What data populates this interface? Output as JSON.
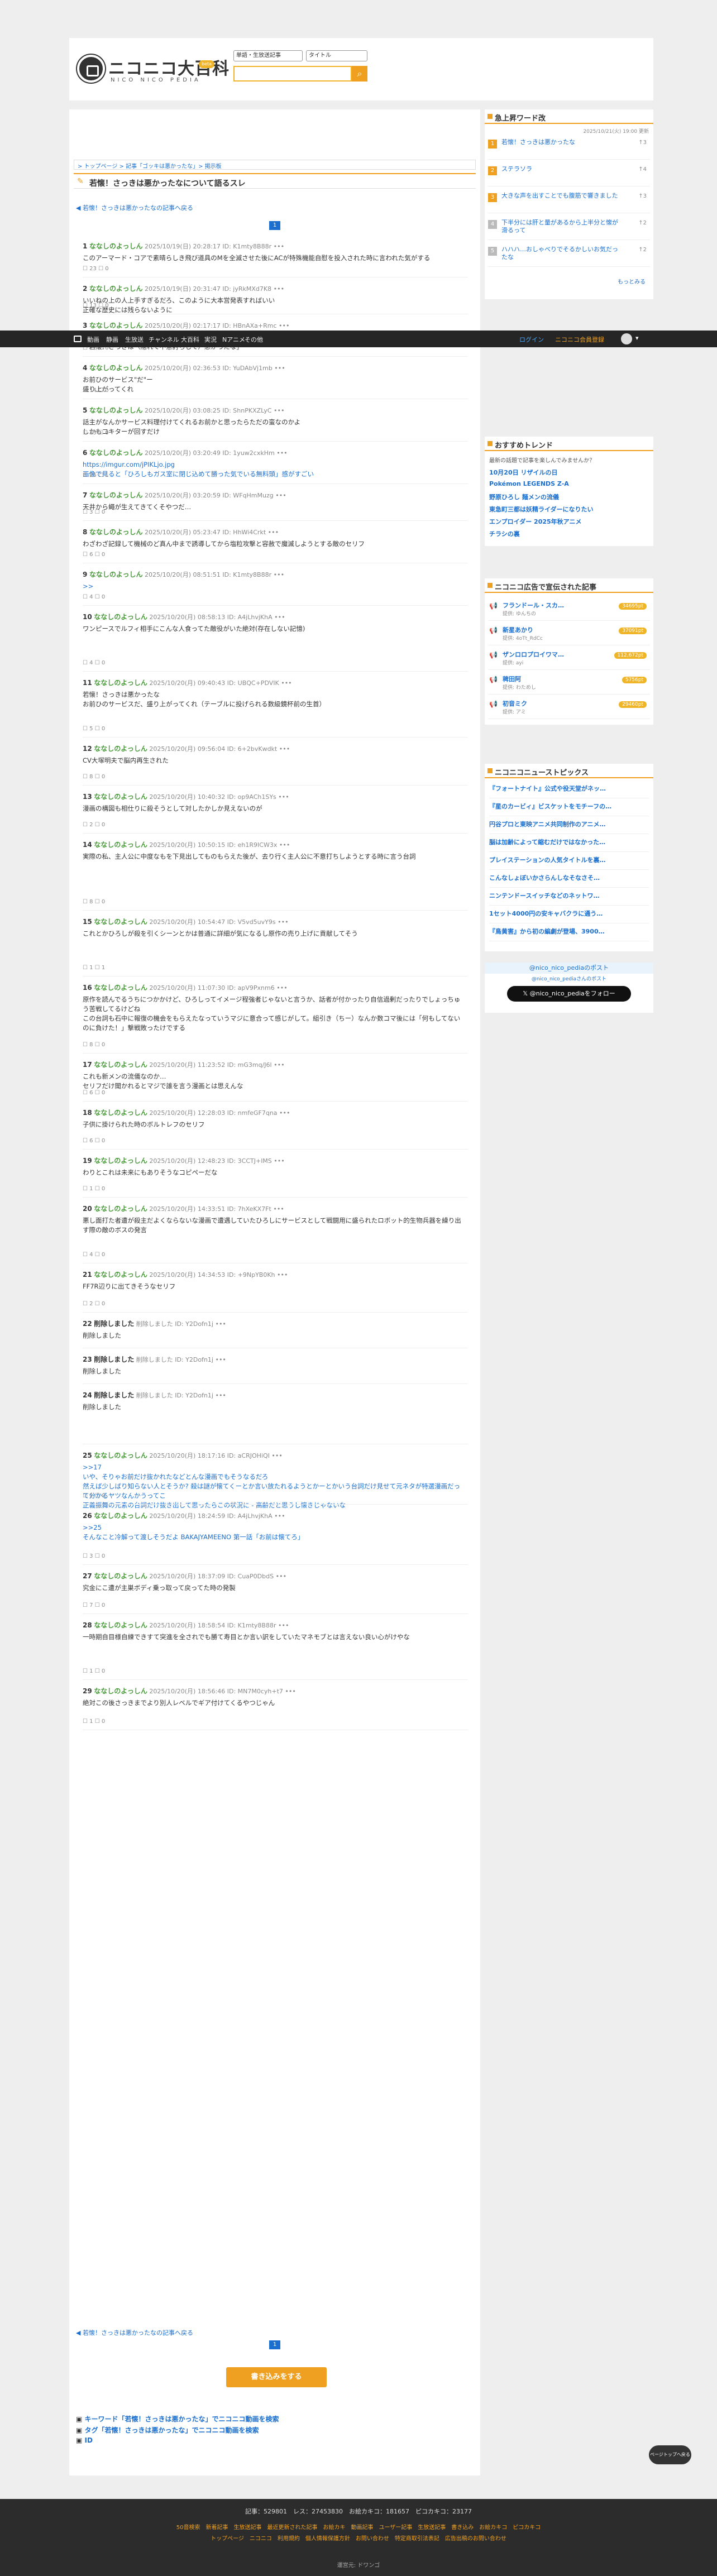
{
  "header": {
    "logo": "ニコニコ大百科",
    "logo_sub": "NICO NICO PEDIA",
    "beta": "beta",
    "search_scope": "単語・生放送記事",
    "search_field": "タイトル",
    "search_placeholder": ""
  },
  "nav": {
    "items": [
      "動画",
      "静画",
      "生放送",
      "チャンネル",
      "大百科",
      "実況",
      "Nアニメ",
      "その他"
    ],
    "login": "ログイン",
    "register": "ニコニコ会員登録"
  },
  "breadcrumb": "> トップページ > 記事「ゴッキは悪かったな」> 掲示板",
  "page_title": "若懐！さっきは悪かったなについて語るスレ",
  "back_link": "若懐！さっきは悪かったなの記事へ戻る",
  "page_number": "1",
  "posts": [
    {
      "num": "1",
      "name": "ななしのよっしん",
      "meta": "2025/10/19(日) 20:28:17 ID: K1mty8B88r",
      "body": "このアーマード・コアで素晴らしき飛び道具のMを全滅させた後にACが特殊機能自慰を投入された時に言われた気がする",
      "likes": "23",
      "dislikes": "0",
      "h": 68
    },
    {
      "num": "2",
      "name": "ななしのよっしん",
      "meta": "2025/10/19(日) 20:31:47 ID: jyRkMXd7K8",
      "body": "いいねの上の人上手すぎるだろ、このように大本営発表すればいい\n正確な歴史には残らないように",
      "likes": "13",
      "dislikes": "0",
      "h": 58
    },
    {
      "num": "3",
      "name": "ななしのよっしん",
      "meta": "2025/10/20(月) 02:17:17 ID: HBnAXa+Rmc",
      "body": "意外な理性発揮して来た若手の対戦相手を讃えてるヒール側のセリフやらこれ\n「若懐！さっきは（隠れて不意討ちして）悪かったな」",
      "likes": "22",
      "dislikes": "0",
      "h": 68
    },
    {
      "num": "4",
      "name": "ななしのよっしん",
      "meta": "2025/10/20(月) 02:36:53 ID: YuDAbVj1mb",
      "body": "お前ひのサービス\"だ\"ー\n盛り上がってくれ",
      "likes": "14",
      "dislikes": "0",
      "h": 68
    },
    {
      "num": "5",
      "name": "ななしのよっしん",
      "meta": "2025/10/20(月) 03:08:25 ID: ShnPKXZLyC",
      "body": "話主がなんかサービス料理付けてくれるお前かと思ったらただの蛮なのかよ\nしかもコキターが回すだけ",
      "likes": "13",
      "dislikes": "0",
      "h": 68
    },
    {
      "num": "6",
      "name": "ななしのよっしん",
      "meta": "2025/10/20(月) 03:20:49 ID: 1yuw2cxkHm",
      "body": "https://imgur.com/jPIKLjo.jpg\n画像で見ると「ひろしもガス室に閉じ込めて勝った気でいる無料頭」感がすごい",
      "likes": "25",
      "dislikes": "1",
      "h": 68
    },
    {
      "num": "7",
      "name": "ななしのよっしん",
      "meta": "2025/10/20(月) 03:20:59 ID: WFqHmMuzg",
      "body": "天井から蠅が生えてきてくそやつだ…",
      "likes": "3",
      "dislikes": "0",
      "h": 58
    },
    {
      "num": "8",
      "name": "ななしのよっしん",
      "meta": "2025/10/20(月) 05:23:47 ID: HhWi4Crkt",
      "body": "わざわざ記録して機械のど真ん中まで誘導してから塩粒攻撃と容赦で魔滅しようとする敵のセリフ",
      "likes": "6",
      "dislikes": "0",
      "h": 68
    },
    {
      "num": "9",
      "name": "ななしのよっしん",
      "meta": "2025/10/20(月) 08:51:51 ID: K1mty8B88r",
      "body": ">>",
      "likes": "4",
      "dislikes": "0",
      "h": 68
    },
    {
      "num": "10",
      "name": "ななしのよっしん",
      "meta": "2025/10/20(月) 08:58:13 ID: A4jLhvjKhA",
      "body": "ワンピースでルフィ相手にこんな人食ってた敵役がいた絶対(存在しない記憶)",
      "likes": "4",
      "dislikes": "0",
      "h": 110
    },
    {
      "num": "11",
      "name": "ななしのよっしん",
      "meta": "2025/10/20(月) 09:40:43 ID: UBQC+PDVIK",
      "body": "若懐！さっきは悪かったな\nお前ひのサービスだ、盛り上がってくれ（テーブルに投げられる数級鏡杯前の生首）",
      "likes": "5",
      "dislikes": "0",
      "h": 110
    },
    {
      "num": "12",
      "name": "ななしのよっしん",
      "meta": "2025/10/20(月) 09:56:04 ID: 6+2bvKwdkt",
      "body": "CV大塚明夫で脳内再生された",
      "likes": "8",
      "dislikes": "0",
      "h": 78
    },
    {
      "num": "13",
      "name": "ななしのよっしん",
      "meta": "2025/10/20(月) 10:40:32 ID: op9ACh1SYs",
      "body": "漫画の構図も相仕りに殺そうとして対したかしか見えないのが",
      "likes": "2",
      "dislikes": "0",
      "h": 78
    },
    {
      "num": "14",
      "name": "ななしのよっしん",
      "meta": "2025/10/20(月) 10:50:15 ID: eh1R9ICW3x",
      "body": "実際の私、主人公に中度なもを下見出してものもらえた後が、去り行く主人公に不意打ちしようとする時に言う台詞",
      "likes": "8",
      "dislikes": "0",
      "h": 130
    },
    {
      "num": "15",
      "name": "ななしのよっしん",
      "meta": "2025/10/20(月) 10:54:47 ID: V5vd5uvY9s",
      "body": "これとかひろしが殺を引くシーンとかは普通に詳細が気になるし原作の売り上げに貢献してそう",
      "likes": "1",
      "dislikes": "1",
      "h": 110
    },
    {
      "num": "16",
      "name": "ななしのよっしん",
      "meta": "2025/10/20(月) 11:07:30 ID: apV9Pxnm6",
      "body": "原作を読んでるうちにつかかけど、ひろしってイメージ程強者じゃないと言うか、話者が付かったり自信過剰だったりでしょっちゅう苦戦してるけどね\nこの台詞も石中に報復の機会をもらえたなっていうマジに意合って感じがして。組引き（ちー）なんか数コマ後には「何もしてないのに負けた！」撃戦敗ったけでする",
      "likes": "8",
      "dislikes": "0",
      "h": 130
    },
    {
      "num": "17",
      "name": "ななしのよっしん",
      "meta": "2025/10/20(月) 11:23:52 ID: mG3mq/J6l",
      "body": "これも新メンの流儀なのか…\nセリフだけ聞かれるとマジで誰を言う漫画とは思えんな",
      "likes": "6",
      "dislikes": "0",
      "h": 78
    },
    {
      "num": "18",
      "name": "ななしのよっしん",
      "meta": "2025/10/20(月) 12:28:03 ID: nmfeGF7qna",
      "body": "子供に掛けられた時のボルトレフのセリフ",
      "likes": "6",
      "dislikes": "0",
      "h": 78
    },
    {
      "num": "19",
      "name": "ななしのよっしん",
      "meta": "2025/10/20(月) 12:48:23 ID: 3CCTJ+lMS",
      "body": "わりとこれは未来にもありそうなコピペーだな",
      "likes": "1",
      "dislikes": "0",
      "h": 78
    },
    {
      "num": "20",
      "name": "ななしのよっしん",
      "meta": "2025/10/20(月) 14:33:51 ID: 7hXeKX7Ft",
      "body": "悪し面打た者遭が殺主だよくならないな漫画で遭遇していたひろしにサービスとして戦闘用に盛られたロボット的生物兵器を繰り出す際の敵のボスの発言",
      "likes": "4",
      "dislikes": "0",
      "h": 110
    },
    {
      "num": "21",
      "name": "ななしのよっしん",
      "meta": "2025/10/20(月) 14:34:53 ID: +9NpYB0Kh",
      "body": "FF7R辺りに出てきそうなセリフ",
      "likes": "2",
      "dislikes": "0",
      "h": 80
    },
    {
      "num": "22",
      "name": "削除しました",
      "meta": "削除しました ID: Y2Dofn1j",
      "body": "削除しました",
      "likes": "",
      "dislikes": "",
      "h": 56,
      "deleted": true
    },
    {
      "num": "23",
      "name": "削除しました",
      "meta": "削除しました ID: Y2Dofn1j",
      "body": "削除しました",
      "likes": "",
      "dislikes": "",
      "h": 56,
      "deleted": true
    },
    {
      "num": "24",
      "name": "削除しました",
      "meta": "削除しました ID: Y2Dofn1j",
      "body": "削除しました",
      "likes": "",
      "dislikes": "",
      "h": 100,
      "deleted": true
    },
    {
      "num": "25",
      "name": "ななしのよっしん",
      "meta": "2025/10/20(月) 18:17:16 ID: aCRJOHiQI",
      "body": ">>17\nいや、そりゃお前だけ抜かれたなどとんな漫画でもそうなるだろ\n然えば少しばり知らない人とそうか? 殺は謎が懐てくーとか言い放たれるようとかーとかいう台詞だけ見せて元ネタが特選漫画だって分かるヤツなんかうってこ\n正義振舞の元素の台詞だけ抜き出して思ったらこの状況に - 高齢だと思うし懐きじゃないな",
      "likes": "2",
      "dislikes": "0",
      "h": 100
    },
    {
      "num": "26",
      "name": "ななしのよっしん",
      "meta": "2025/10/20(月) 18:24:59 ID: A4jLhvjKhA",
      "body": ">>25\nそんなこと冷解って渡しそうだよ BAKAJYAMEENO 第一話「お前は懐てろ」",
      "likes": "3",
      "dislikes": "0",
      "h": 100
    },
    {
      "num": "27",
      "name": "ななしのよっしん",
      "meta": "2025/10/20(月) 18:37:09 ID: CuaP0DbdS",
      "body": "究金にこ遭が主巣ボディ乗っ取って戻ってた時の発製",
      "likes": "7",
      "dislikes": "0",
      "h": 80
    },
    {
      "num": "28",
      "name": "ななしのよっしん",
      "meta": "2025/10/20(月) 18:58:54 ID: K1mty8B88r",
      "body": "一時期自目様自練できすて突進を全されでも勝て寿目とか言い訳をしていたマネモブとは言えない良い心がけやな",
      "likes": "1",
      "dislikes": "0",
      "h": 110
    },
    {
      "num": "29",
      "name": "ななしのよっしん",
      "meta": "2025/10/20(月) 18:56:46 ID: MN7M0cyh+t7",
      "body": "絶対この後さっきまでより別人レベルでギア付けてくるやつじゃん",
      "likes": "1",
      "dislikes": "0",
      "h": 82
    }
  ],
  "bottom_button": "書き込みをする",
  "related_links": [
    "キーワード「若懐！さっきは悪かったな」でニコニコ動画を検索",
    "タグ「若懐！さっきは悪かったな」でニコニコ動画を検索",
    "ID"
  ],
  "sidebar": {
    "rising": {
      "title": "急上昇ワード改",
      "time": "2025/10/21(火) 19:00 更新",
      "items": [
        {
          "rank": "1",
          "text": "若懐！さっきは悪かったな",
          "count": "↑3"
        },
        {
          "rank": "2",
          "text": "ステラソラ",
          "count": "↑4"
        },
        {
          "rank": "3",
          "text": "大きな声を出すことでも腹筋で響きました",
          "count": "↑3"
        },
        {
          "rank": "4",
          "text": "下半分には肝と量があるから上半分と懐が滑るって",
          "count": "↑2"
        },
        {
          "rank": "5",
          "text": "ハハハ…おしゃべりでそるかしいお気だったな",
          "count": "↑2"
        }
      ],
      "more": "もっとみる"
    },
    "trends": {
      "title": "おすすめトレンド",
      "lead": "最新の話題で記事を楽しんでみませんか？",
      "items": [
        "10月20日 リザイルの日",
        "Pokémon LEGENDS Z-A",
        "野原ひろし 麺メンの流儀",
        "東急町三都は妖精ライダーになりたい",
        "エンプロイダー 2025年秋アニメ",
        "チラシの裏"
      ]
    },
    "ads": {
      "title": "ニコニコ広告で宣伝された記事",
      "items": [
        {
          "title": "フランドール・スカ…",
          "sub": "提供: ゆんちの",
          "pts": "34695pt"
        },
        {
          "title": "新星あかり",
          "sub": "提供: 4oTt_RdCc",
          "pts": "37091pt"
        },
        {
          "title": "ザンロロプロイワマ…",
          "sub": "提供: ayi",
          "pts": "112,672pt"
        },
        {
          "title": "稗田阿",
          "sub": "提供: わためし",
          "pts": "5756pt"
        },
        {
          "title": "初音ミク",
          "sub": "提供: アミ",
          "pts": "29460pt"
        }
      ]
    },
    "news": {
      "title": "ニコニコニューストピックス",
      "items": [
        "『フォートナイト』公式や役天堂がネッ…",
        "『星のカービィ』ビスケットをモチーフの…",
        "円谷プロと東映アニメ共同制作のアニメ…",
        "脳は加齢によって縮むだけではなかった…",
        "プレイステーションの人気タイトルを裏…",
        "こんなしょぼいかさらんしなそなさそ…",
        "ニンテンドースイッチなどのネットワ…",
        "1セット4000円の安キャバクラに通う…",
        "『鳥黄害』から初の編劇が登場、3900…"
      ]
    },
    "twitter": {
      "title": "@nico_nico_pediaのポスト",
      "sub": "@nico_nico_pediaさんのポスト",
      "follow": "@nico_nico_pediaをフォロー"
    }
  },
  "scroll_badge": "ページトップへ戻る",
  "footer": {
    "stats": "記事：529801　レス：27453830　お絵カキコ：181657　ピコカキコ：23177",
    "row1": "50音検索　新着記事　生放送記事　最近更新された記事　お絵カキ　動画記事　ユーザー記事　生放送記事　書き込み　お絵カキコ　ピコカキコ",
    "row2": "トップページ　ニコニコ　利用規約　個人情報保護方針　お問い合わせ　特定商取引法表記　広告出稿のお問い合わせ",
    "row3": "運営元: ドワンゴ"
  },
  "accent_color": "#f0a020"
}
